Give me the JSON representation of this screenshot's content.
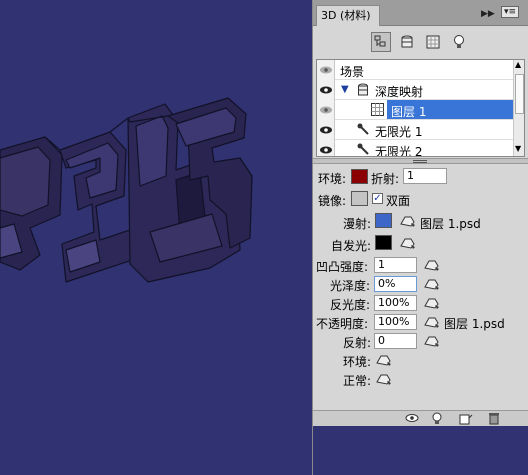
{
  "panel": {
    "tab_title": "3D (材料)",
    "colors": {
      "ambient": "#8b0000",
      "reflection": "#c4c4c4",
      "diffuse": "#3d66c8",
      "self_illumination": "#000000",
      "canvas_bg": "#313271",
      "selection": "#3875d7"
    }
  },
  "tree": {
    "items": [
      {
        "label": "场景",
        "icon": "none"
      },
      {
        "label": "深度映射",
        "icon": "cylinder-mesh-icon"
      },
      {
        "label": "图层 1",
        "icon": "material-grid-icon",
        "selected": true
      },
      {
        "label": "无限光 1",
        "icon": "light-icon"
      },
      {
        "label": "无限光 2",
        "icon": "light-icon"
      }
    ]
  },
  "props": {
    "ambient_label": "环境:",
    "refraction_label": "折射:",
    "refraction_value": "1",
    "reflection_label": "镜像:",
    "double_sided_label": "双面",
    "double_sided_checked": true,
    "diffuse_label": "漫射:",
    "diffuse_texture": "图层 1.psd",
    "self_illum_label": "自发光:",
    "bump_label": "凹凸强度:",
    "bump_value": "1",
    "gloss_label": "光泽度:",
    "gloss_value": "0%",
    "shine_label": "反光度:",
    "shine_value": "100%",
    "opacity_label": "不透明度:",
    "opacity_value": "100%",
    "opacity_texture": "图层 1.psd",
    "reflect_label": "反射:",
    "reflect_value": "0",
    "env_label": "环境:",
    "normal_label": "正常:"
  }
}
